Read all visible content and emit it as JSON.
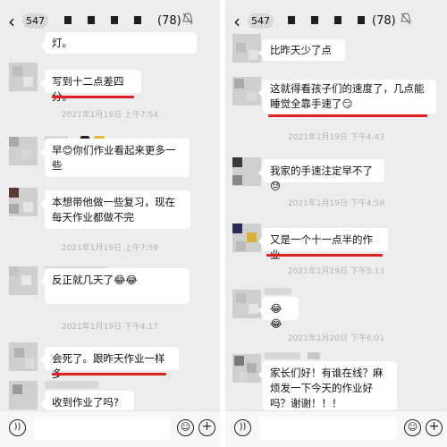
{
  "left": {
    "header": {
      "back_icon": "chevron-left-icon",
      "unread_count": "547",
      "member_count": "(78)",
      "mute_icon": "mute-icon"
    },
    "messages": [
      {
        "text": "灯。"
      },
      {
        "text": "写到十二点差四分。"
      },
      {
        "timestamp": "2021年1月19日 上午7:54"
      },
      {
        "text": "早😊你们作业看起来更多一些"
      },
      {
        "text": "本想带他做一些复习，现在每天作业都做不完"
      },
      {
        "timestamp": "2021年1月19日 上午7:59"
      },
      {
        "text": "反正就几天了😂😂"
      },
      {
        "timestamp": "2021年1月19日 下午4:17"
      },
      {
        "text": "会死了。跟昨天作业一样多"
      },
      {
        "text": "收到作业了吗?"
      }
    ],
    "input_bar": {
      "voice_icon": "voice-icon",
      "emoji_icon": "emoji-icon",
      "plus_icon": "plus-icon"
    }
  },
  "right": {
    "header": {
      "back_icon": "chevron-left-icon",
      "unread_count": "547",
      "member_count": "(78)",
      "mute_icon": "mute-icon"
    },
    "messages": [
      {
        "text": "比昨天少了点"
      },
      {
        "text": "这就得看孩子们的速度了，几点能睡觉全靠手速了😏"
      },
      {
        "timestamp": "2021年1月19日 下午4:43"
      },
      {
        "text": "我家的手速注定早不了😓"
      },
      {
        "timestamp": "2021年1月19日 下午4:58"
      },
      {
        "text": "又是一个十一点半的作业"
      },
      {
        "timestamp": "2021年1月19日 下午5:13"
      },
      {
        "text": "😂😂"
      },
      {
        "timestamp": "2021年1月20日 下午6:01"
      },
      {
        "text": "家长们好！有谁在线？麻烦发一下今天的作业好吗？谢谢！！！"
      }
    ],
    "input_bar": {
      "voice_icon": "voice-icon",
      "emoji_icon": "emoji-icon",
      "plus_icon": "plus-icon"
    }
  },
  "colors": {
    "chat_bg": "#ededed",
    "bubble": "#ffffff",
    "annotation_red": "#e02020",
    "timestamp": "#b5b5b5"
  }
}
